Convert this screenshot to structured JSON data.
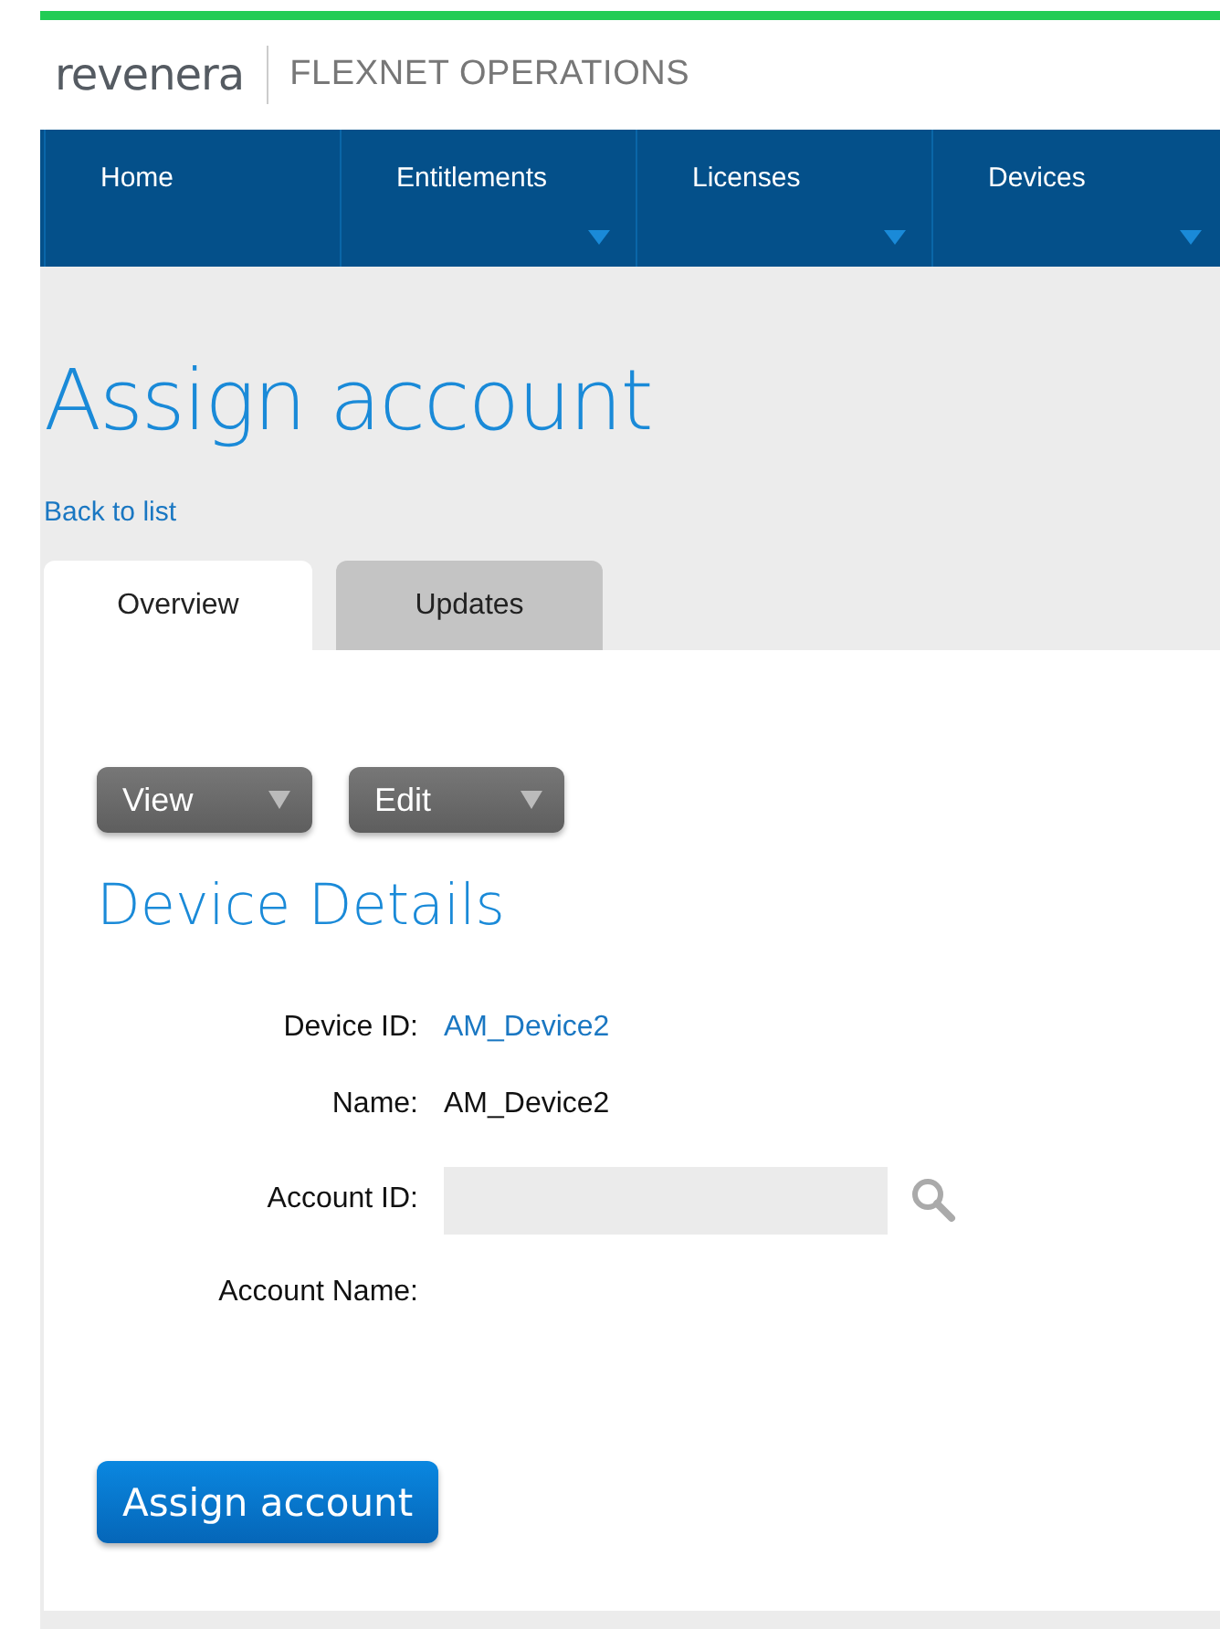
{
  "brand": {
    "logo": "revenera",
    "product": "FLEXNET OPERATIONS"
  },
  "nav": [
    {
      "label": "Home",
      "has_menu": false
    },
    {
      "label": "Entitlements",
      "has_menu": true
    },
    {
      "label": "Licenses",
      "has_menu": true
    },
    {
      "label": "Devices",
      "has_menu": true
    }
  ],
  "page_title": "Assign account",
  "back_link": "Back to list",
  "tabs": [
    {
      "label": "Overview",
      "selected": true
    },
    {
      "label": "Updates",
      "selected": false
    }
  ],
  "menu_buttons": [
    "View",
    "Edit"
  ],
  "section_title": "Device Details",
  "fields": [
    {
      "label": "Device ID:",
      "kind": "link",
      "value": "AM_Device2"
    },
    {
      "label": "Name:",
      "kind": "text",
      "value": "AM_Device2"
    },
    {
      "label": "Account ID:",
      "kind": "lookup"
    },
    {
      "label": "Account Name:",
      "kind": "text"
    }
  ],
  "submit": "Assign account"
}
